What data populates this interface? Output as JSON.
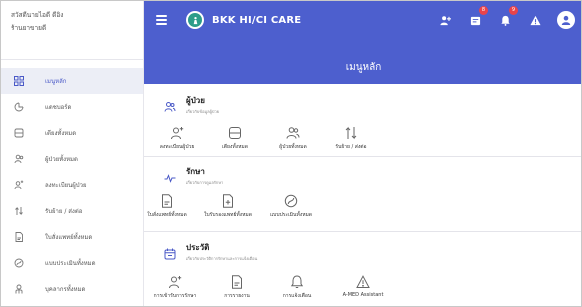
{
  "brand": {
    "line1": "สวัสดีนายไอดี ดีอิง",
    "line2": "ร้านยาขายดี"
  },
  "sidebar": {
    "items": [
      {
        "label": "เมนูหลัก",
        "icon": "grid-icon",
        "active": true
      },
      {
        "label": "แดชบอร์ด",
        "icon": "dashboard-icon"
      },
      {
        "label": "เตียงทั้งหมด",
        "icon": "bed-icon"
      },
      {
        "label": "ผู้ป่วยทั้งหมด",
        "icon": "patients-icon"
      },
      {
        "label": "ลงทะเบียนผู้ป่วย",
        "icon": "register-patient-icon"
      },
      {
        "label": "รับย้าย / ส่งต่อ",
        "icon": "transfer-icon"
      },
      {
        "label": "ใบสั่งแพทย์ทั้งหมด",
        "icon": "doctor-order-icon"
      },
      {
        "label": "แบบประเมินทั้งหมด",
        "icon": "assessment-icon"
      },
      {
        "label": "บุคลากรทั้งหมด",
        "icon": "staff-icon"
      }
    ]
  },
  "topbar": {
    "app_title": "BKK HI/CI CARE",
    "badges": {
      "notifications": "8",
      "alerts": "9"
    }
  },
  "header": {
    "title": "เมนูหลัก"
  },
  "sections": [
    {
      "title": "ผู้ป่วย",
      "subtitle": "เกี่ยวกับข้อมูลผู้ป่วย",
      "tiles": [
        {
          "label": "ลงทะเบียนผู้ป่วย",
          "icon": "add-user-icon"
        },
        {
          "label": "เตียงทั้งหมด",
          "icon": "bed-icon"
        },
        {
          "label": "ผู้ป่วยทั้งหมด",
          "icon": "patients-icon"
        },
        {
          "label": "รับย้าย / ส่งต่อ",
          "icon": "transfer-icon"
        }
      ]
    },
    {
      "title": "รักษา",
      "subtitle": "เกี่ยวกับการดูแลรักษา",
      "tiles": [
        {
          "label": "ใบสั่งแพทย์ทั้งหมด",
          "icon": "doctor-order-icon"
        },
        {
          "label": "ใบรับรองแพทย์ทั้งหมด",
          "icon": "medical-certificate-icon"
        },
        {
          "label": "แบบประเมินทั้งหมด",
          "icon": "assessment-icon"
        }
      ]
    },
    {
      "title": "ประวัติ",
      "subtitle": "เกี่ยวกับประวัติการรักษาและการแจ้งเตือน",
      "tiles": [
        {
          "label": "การเข้ารับการรักษา",
          "icon": "admission-icon"
        },
        {
          "label": "การรายงาน",
          "icon": "report-icon"
        },
        {
          "label": "การแจ้งเตือน",
          "icon": "bell-icon"
        },
        {
          "label": "A-MED Assistant",
          "icon": "warning-icon"
        }
      ]
    }
  ],
  "colors": {
    "primary": "#4d5fce",
    "badge": "#e9434a",
    "active_bg": "#eceef6"
  }
}
